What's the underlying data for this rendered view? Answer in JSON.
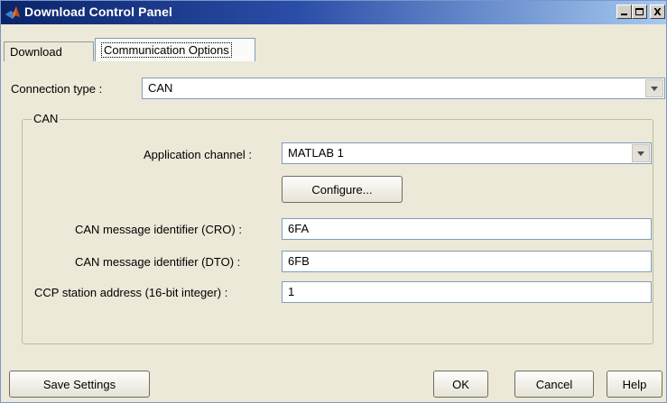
{
  "window": {
    "title": "Download Control Panel",
    "icon": "matlab-icon",
    "controls": {
      "minimize": "_",
      "maximize": "□",
      "close": "X"
    }
  },
  "tabs": [
    {
      "label": "Download",
      "selected": false
    },
    {
      "label": "Communication Options",
      "selected": true
    }
  ],
  "connection": {
    "label": "Connection type :",
    "value": "CAN"
  },
  "can_group": {
    "title": "CAN",
    "application_channel": {
      "label": "Application channel :",
      "value": "MATLAB 1"
    },
    "configure_label": "Configure...",
    "cro": {
      "label": "CAN message identifier (CRO) :",
      "value": "6FA"
    },
    "dto": {
      "label": "CAN message identifier (DTO) :",
      "value": "6FB"
    },
    "station": {
      "label": "CCP station address (16-bit integer) :",
      "value": "1"
    }
  },
  "footer": {
    "save_label": "Save Settings",
    "ok_label": "OK",
    "cancel_label": "Cancel",
    "help_label": "Help"
  },
  "colors": {
    "title_gradient_start": "#0a246a",
    "title_gradient_end": "#a6caf0",
    "dialog_bg": "#ece9d8",
    "field_border": "#7f9db9"
  }
}
